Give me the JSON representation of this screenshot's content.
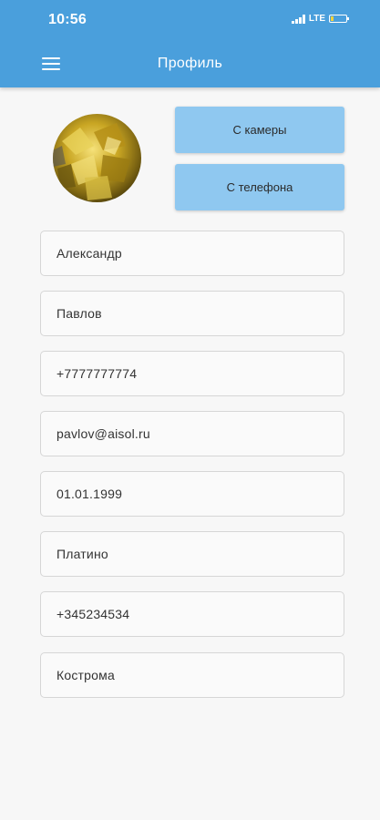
{
  "status_bar": {
    "time": "10:56",
    "network": "LTE"
  },
  "app_bar": {
    "title": "Профиль",
    "menu_icon": "hamburger-menu-icon",
    "background_color": "#4a9fdc"
  },
  "photo": {
    "avatar_description": "gold foil avatar",
    "camera_button_label": "С камеры",
    "phone_button_label": "С телефона",
    "button_color": "#8fc8f0"
  },
  "form": {
    "fields": [
      {
        "value": "Александр"
      },
      {
        "value": "Павлов"
      },
      {
        "value": "+7777777774"
      },
      {
        "value": "pavlov@aisol.ru"
      },
      {
        "value": "01.01.1999"
      },
      {
        "value": "Платино"
      },
      {
        "value": "+345234534"
      },
      {
        "value": "Кострома"
      }
    ]
  }
}
